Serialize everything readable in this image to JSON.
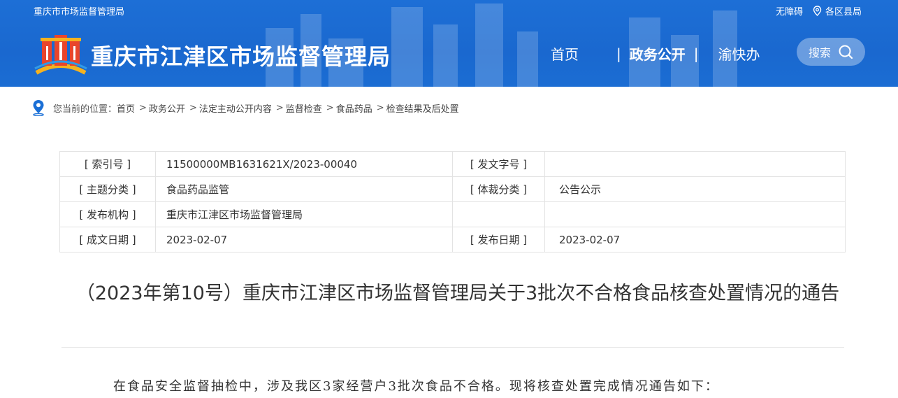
{
  "header": {
    "top_left": "重庆市市场监督管理局",
    "accessibility": "无障碍",
    "region": "各区县局",
    "site_title": "重庆市江津区市场监督管理局",
    "nav": {
      "home": "首页",
      "gov": "政务公开",
      "yu": "渝快办",
      "sep": "|"
    },
    "search_label": "搜索"
  },
  "breadcrumb": {
    "prefix": "您当前的位置：",
    "items": [
      "首页",
      "政务公开",
      "法定主动公开内容",
      "监督检查",
      "食品药品",
      "检查结果及后处置"
    ],
    "sep": ">"
  },
  "meta": {
    "rows": [
      {
        "k1": "[ 索引号 ]",
        "v1": "11500000MB1631621X/2023-00040",
        "k2": "[ 发文字号 ]",
        "v2": ""
      },
      {
        "k1": "[ 主题分类 ]",
        "v1": "食品药品监管",
        "k2": "[ 体裁分类 ]",
        "v2": "公告公示"
      },
      {
        "k1": "[ 发布机构 ]",
        "v1": "重庆市江津区市场监督管理局",
        "k2": "",
        "v2": ""
      },
      {
        "k1": "[ 成文日期 ]",
        "v1": "2023-02-07",
        "k2": "[ 发布日期 ]",
        "v2": "2023-02-07"
      }
    ]
  },
  "document": {
    "title": "（2023年第10号）重庆市江津区市场监督管理局关于3批次不合格食品核查处置情况的通告",
    "intro": "在食品安全监督抽检中，涉及我区3家经营户3批次食品不合格。现将核查处置完成情况通告如下："
  },
  "icons": {
    "pin": "location-pin-icon",
    "search": "search-icon",
    "region": "location-icon"
  },
  "colors": {
    "header_blue": "#1a68cf",
    "pin_blue": "#1a6fd6"
  }
}
